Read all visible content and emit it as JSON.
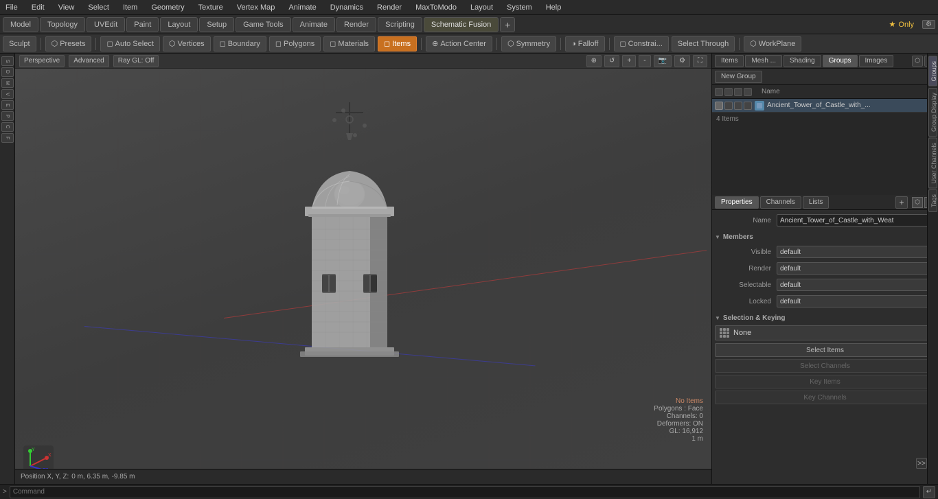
{
  "menu": {
    "items": [
      "File",
      "Edit",
      "View",
      "Select",
      "Item",
      "Geometry",
      "Texture",
      "Vertex Map",
      "Animate",
      "Dynamics",
      "Render",
      "MaxToModo",
      "Layout",
      "System",
      "Help"
    ]
  },
  "tabs": {
    "items": [
      "Model",
      "Topology",
      "UVEdit",
      "Paint",
      "Layout",
      "Setup",
      "Game Tools",
      "Animate",
      "Render",
      "Scripting",
      "Schematic Fusion"
    ],
    "active": "Schematic Fusion",
    "plus_label": "+",
    "star_label": "★ Only"
  },
  "toolbar": {
    "sculpt_label": "Sculpt",
    "presets_label": "Presets",
    "auto_select_label": "Auto Select",
    "vertices_label": "Vertices",
    "boundary_label": "Boundary",
    "polygons_label": "Polygons",
    "materials_label": "Materials",
    "items_label": "Items",
    "action_center_label": "Action Center",
    "symmetry_label": "Symmetry",
    "falloff_label": "Falloff",
    "constraints_label": "Constrai...",
    "select_through_label": "Select Through",
    "workplane_label": "WorkPlane"
  },
  "viewport": {
    "perspective_label": "Perspective",
    "advanced_label": "Advanced",
    "ray_gl_label": "Ray GL: Off",
    "info": {
      "no_items_label": "No Items",
      "polygons_label": "Polygons : Face",
      "channels_label": "Channels: 0",
      "deformers_label": "Deformers: ON",
      "gl_label": "GL: 16,912",
      "scale_label": "1 m"
    }
  },
  "groups_panel": {
    "tabs": [
      "Items",
      "Mesh ...",
      "Shading",
      "Groups",
      "Images"
    ],
    "active_tab": "Groups",
    "new_group_label": "New Group",
    "col_header": "Name",
    "group_item": {
      "name": "Ancient_Tower_of_Castle_with_...",
      "count": "4 Items"
    }
  },
  "properties_panel": {
    "tabs": [
      "Properties",
      "Channels",
      "Lists"
    ],
    "active_tab": "Properties",
    "name_label": "Name",
    "name_value": "Ancient_Tower_of_Castle_with_Weat",
    "members_section": "Members",
    "visible_label": "Visible",
    "visible_value": "default",
    "render_label": "Render",
    "render_value": "default",
    "selectable_label": "Selectable",
    "selectable_value": "default",
    "locked_label": "Locked",
    "locked_value": "default",
    "selection_keying_section": "Selection & Keying",
    "keying_none_label": "None",
    "select_items_label": "Select Items",
    "select_channels_label": "Select Channels",
    "key_items_label": "Key Items",
    "key_channels_label": "Key Channels"
  },
  "right_vtabs": {
    "items": [
      "Groups",
      "Group Display",
      "User Channels",
      "Tags"
    ]
  },
  "command_bar": {
    "arrow_label": ">",
    "placeholder": "Command",
    "submit_label": "↵"
  },
  "status_bar": {
    "position_label": "Position X, Y, Z:",
    "position_value": "0 m, 6.35 m, -9.85 m"
  }
}
